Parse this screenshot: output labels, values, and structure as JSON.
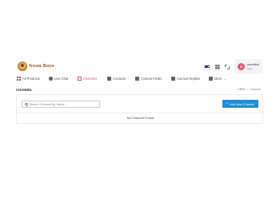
{
  "brand": {
    "logo_text": "Neon Boys"
  },
  "header": {
    "user": {
      "initial": "N",
      "name": "navedkat",
      "role": "Main"
    }
  },
  "nav": {
    "items": [
      {
        "label": "All Products"
      },
      {
        "label": "Live Chat"
      },
      {
        "label": "Channels"
      },
      {
        "label": "Contacts"
      },
      {
        "label": "Custom Fields"
      },
      {
        "label": "Canned Replies"
      },
      {
        "label": "More"
      }
    ]
  },
  "page": {
    "title": "CHANNEL",
    "breadcrumb": {
      "root": "CRM",
      "separator": ">",
      "current": "Channel"
    }
  },
  "toolbar": {
    "search_placeholder": "Search Channel By Name...",
    "add_label": "Add New Channel"
  },
  "table": {
    "empty_message": "No Channel Found"
  },
  "colors": {
    "accent": "#e0547a",
    "primary_button": "#1c8fd6"
  }
}
